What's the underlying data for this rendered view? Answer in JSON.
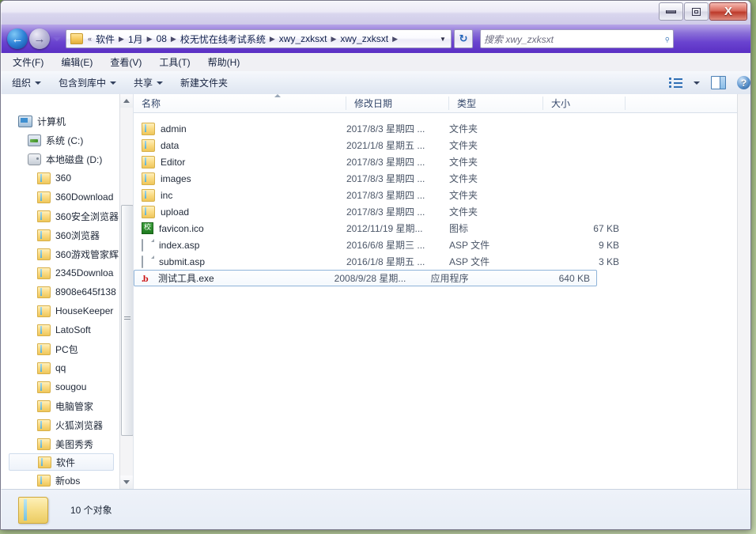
{
  "window": {
    "controls": {
      "minimize": "–",
      "maximize": "□",
      "close": "X"
    }
  },
  "address": {
    "back_icon": "←",
    "forward_icon": "→",
    "dropdown_icon": "▼",
    "refresh_icon": "↻",
    "separator": "▶",
    "root_marker": "«",
    "crumbs": [
      "软件",
      "1月",
      "08",
      "校无忧在线考试系统",
      "xwy_zxksxt",
      "xwy_zxksxt"
    ]
  },
  "search": {
    "placeholder": "搜索 xwy_zxksxt",
    "icon": "⌕"
  },
  "menubar": {
    "items": [
      "文件(F)",
      "编辑(E)",
      "查看(V)",
      "工具(T)",
      "帮助(H)"
    ]
  },
  "toolbar": {
    "items": [
      {
        "label": "组织",
        "has_caret": true
      },
      {
        "label": "包含到库中",
        "has_caret": true
      },
      {
        "label": "共享",
        "has_caret": true
      },
      {
        "label": "新建文件夹",
        "has_caret": false
      }
    ],
    "right_icons": [
      "views-icon",
      "chevron-down-icon",
      "preview-pane-icon",
      "help-icon"
    ],
    "help_glyph": "?"
  },
  "navpane": {
    "items": [
      {
        "label": "计算机",
        "icon": "computer-icon",
        "level": 0,
        "selected": false
      },
      {
        "label": "系统 (C:)",
        "icon": "drive-system-icon",
        "level": 1,
        "selected": false
      },
      {
        "label": "本地磁盘 (D:)",
        "icon": "drive-icon",
        "level": 1,
        "selected": false
      },
      {
        "label": "360",
        "icon": "folder-icon",
        "level": 2,
        "selected": false
      },
      {
        "label": "360Download",
        "icon": "folder-icon",
        "level": 2,
        "selected": false
      },
      {
        "label": "360安全浏览器",
        "icon": "folder-icon",
        "level": 2,
        "selected": false
      },
      {
        "label": "360浏览器",
        "icon": "folder-icon",
        "level": 2,
        "selected": false
      },
      {
        "label": "360游戏管家辉",
        "icon": "folder-icon",
        "level": 2,
        "selected": false
      },
      {
        "label": "2345Downloa",
        "icon": "folder-icon",
        "level": 2,
        "selected": false
      },
      {
        "label": "8908e645f138",
        "icon": "folder-icon",
        "level": 2,
        "selected": false
      },
      {
        "label": "HouseKeeper",
        "icon": "folder-icon",
        "level": 2,
        "selected": false
      },
      {
        "label": "LatoSoft",
        "icon": "folder-icon",
        "level": 2,
        "selected": false
      },
      {
        "label": "PC包",
        "icon": "folder-icon",
        "level": 2,
        "selected": false
      },
      {
        "label": "qq",
        "icon": "folder-icon",
        "level": 2,
        "selected": false
      },
      {
        "label": "sougou",
        "icon": "folder-icon",
        "level": 2,
        "selected": false
      },
      {
        "label": "电脑管家",
        "icon": "folder-icon",
        "level": 2,
        "selected": false
      },
      {
        "label": "火狐浏览器",
        "icon": "folder-icon",
        "level": 2,
        "selected": false
      },
      {
        "label": "美图秀秀",
        "icon": "folder-icon",
        "level": 2,
        "selected": false
      },
      {
        "label": "软件",
        "icon": "folder-icon",
        "level": 2,
        "selected": true
      },
      {
        "label": "新obs",
        "icon": "folder-icon",
        "level": 2,
        "selected": false
      }
    ]
  },
  "filelist": {
    "columns": [
      "名称",
      "修改日期",
      "类型",
      "大小"
    ],
    "sort_column": "名称",
    "sort_direction": "ascending",
    "rows": [
      {
        "name": "admin",
        "date": "2017/8/3 星期四 ...",
        "type": "文件夹",
        "size": "",
        "icon": "folder-icon",
        "selected": false
      },
      {
        "name": "data",
        "date": "2021/1/8 星期五 ...",
        "type": "文件夹",
        "size": "",
        "icon": "folder-icon",
        "selected": false
      },
      {
        "name": "Editor",
        "date": "2017/8/3 星期四 ...",
        "type": "文件夹",
        "size": "",
        "icon": "folder-icon",
        "selected": false
      },
      {
        "name": "images",
        "date": "2017/8/3 星期四 ...",
        "type": "文件夹",
        "size": "",
        "icon": "folder-icon",
        "selected": false
      },
      {
        "name": "inc",
        "date": "2017/8/3 星期四 ...",
        "type": "文件夹",
        "size": "",
        "icon": "folder-icon",
        "selected": false
      },
      {
        "name": "upload",
        "date": "2017/8/3 星期四 ...",
        "type": "文件夹",
        "size": "",
        "icon": "folder-icon",
        "selected": false
      },
      {
        "name": "favicon.ico",
        "date": "2012/11/19 星期...",
        "type": "图标",
        "size": "67 KB",
        "icon": "ico-file-icon",
        "selected": false
      },
      {
        "name": "index.asp",
        "date": "2016/6/8 星期三 ...",
        "type": "ASP 文件",
        "size": "9 KB",
        "icon": "document-icon",
        "selected": false
      },
      {
        "name": "submit.asp",
        "date": "2016/1/8 星期五 ...",
        "type": "ASP 文件",
        "size": "3 KB",
        "icon": "document-icon",
        "selected": false
      },
      {
        "name": "测试工具.exe",
        "date": "2008/9/28 星期...",
        "type": "应用程序",
        "size": "640 KB",
        "icon": "exe-file-icon",
        "selected": true
      }
    ],
    "ico_glyph": "校",
    "exe_glyph": ".b"
  },
  "statusbar": {
    "item_count": "10 个对象"
  },
  "colors": {
    "addressbar_purple": "#6a43cf",
    "accent_blue": "#2f6fb5",
    "folder_yellow": "#f6c95c",
    "close_red": "#bc3a2a"
  }
}
